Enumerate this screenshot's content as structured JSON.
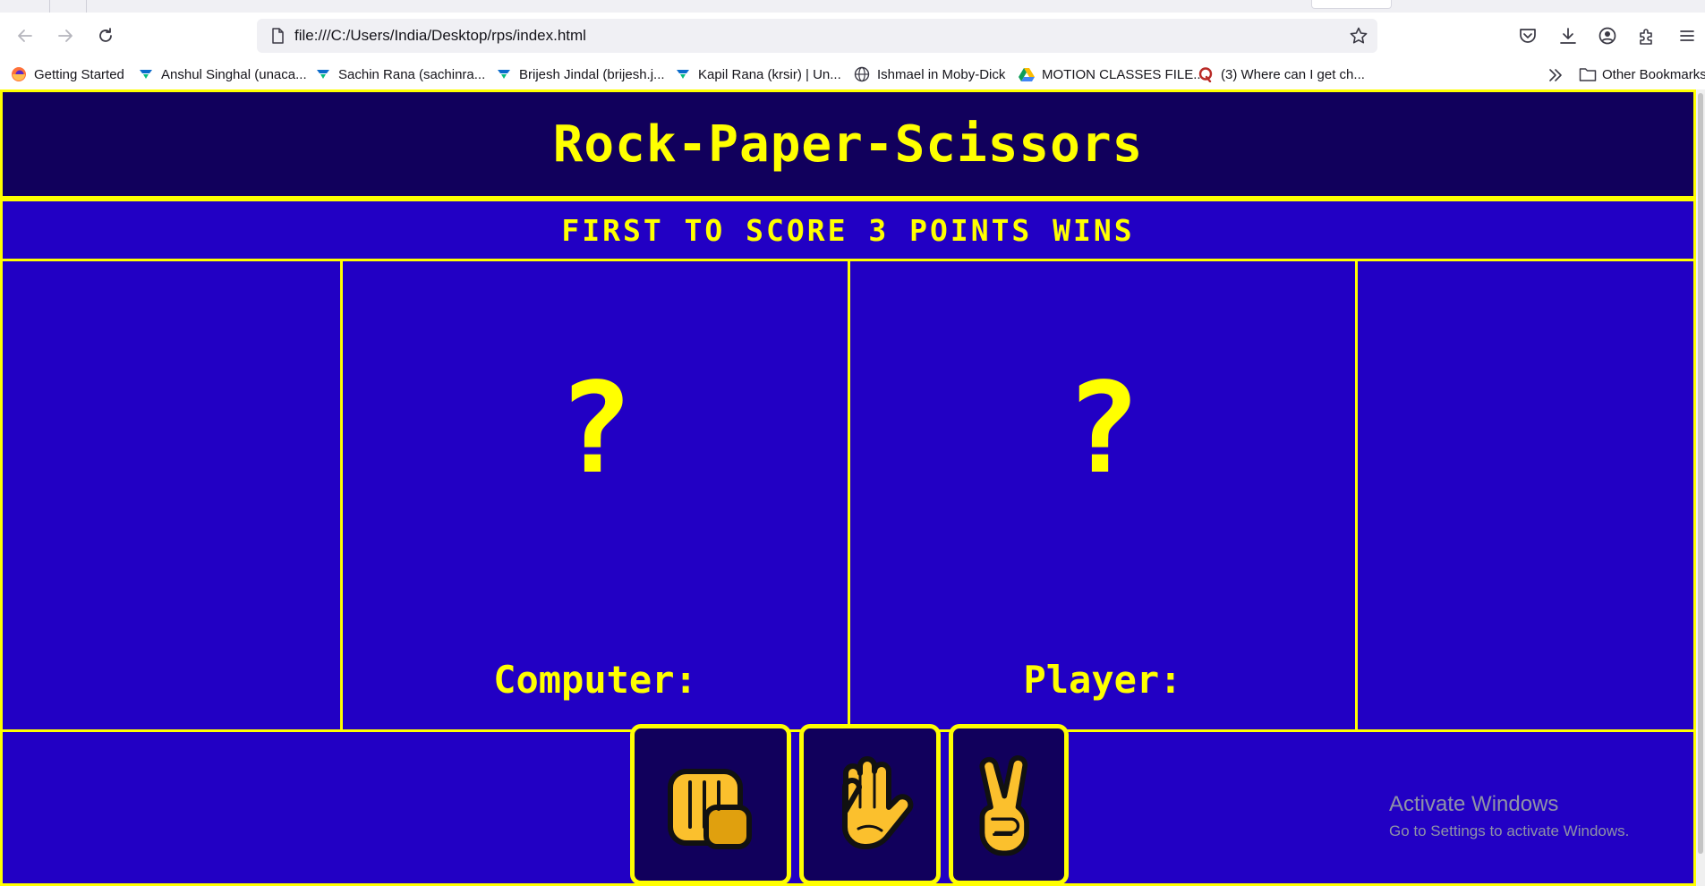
{
  "browser": {
    "url": "file:///C:/Users/India/Desktop/rps/index.html",
    "bookmarks": [
      {
        "label": "Getting Started",
        "icon": "firefox-icon"
      },
      {
        "label": "Anshul Singhal (unaca...",
        "icon": "unacademy-icon"
      },
      {
        "label": "Sachin Rana (sachinra...",
        "icon": "unacademy-icon"
      },
      {
        "label": "Brijesh Jindal (brijesh.j...",
        "icon": "unacademy-icon"
      },
      {
        "label": "Kapil Rana (krsir) | Un...",
        "icon": "unacademy-icon"
      },
      {
        "label": "Ishmael in Moby-Dick",
        "icon": "globe-icon"
      },
      {
        "label": "MOTION CLASSES FILE...",
        "icon": "google-drive-icon"
      },
      {
        "label": "(3) Where can I get ch...",
        "icon": "quora-icon"
      }
    ],
    "other_bookmarks": "Other Bookmarks"
  },
  "game": {
    "title": "Rock-Paper-Scissors",
    "banner": "FIRST TO SCORE 3 POINTS WINS",
    "computer": {
      "choice": "?",
      "label": "Computer:"
    },
    "player": {
      "choice": "?",
      "label": "Player:"
    },
    "choices": [
      {
        "name": "rock",
        "icon": "fist-icon"
      },
      {
        "name": "paper",
        "icon": "raised-hand-icon"
      },
      {
        "name": "scissors",
        "icon": "victory-hand-icon"
      }
    ]
  },
  "watermark": {
    "title": "Activate Windows",
    "subtitle": "Go to Settings to activate Windows."
  },
  "colors": {
    "accent": "#ffff00",
    "title_bg": "#11005c",
    "panel_bg": "#2200c4",
    "hand": "#fbc02d"
  }
}
